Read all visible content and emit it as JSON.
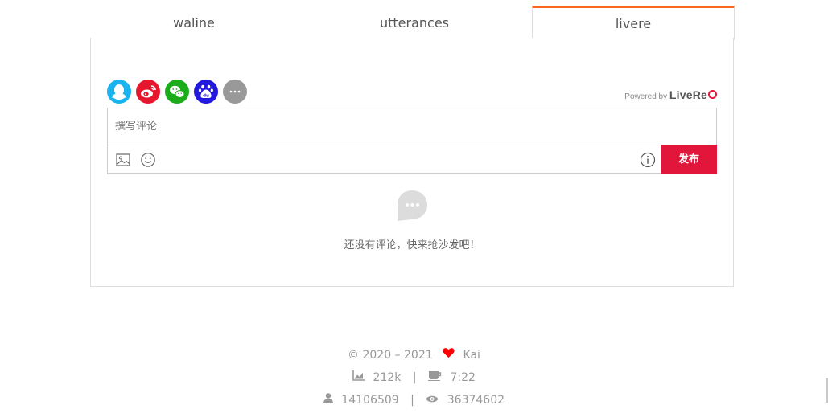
{
  "tabs": [
    {
      "label": "waline"
    },
    {
      "label": "utterances"
    },
    {
      "label": "livere",
      "active": true
    }
  ],
  "accent_color": "#fc6423",
  "livere": {
    "social_logins": [
      {
        "icon": "qq-icon",
        "color": "#1ab3f0"
      },
      {
        "icon": "weibo-icon",
        "color": "#e6162d"
      },
      {
        "icon": "wechat-icon",
        "color": "#1aad19"
      },
      {
        "icon": "baidu-icon",
        "color": "#2319dc"
      },
      {
        "icon": "more-icon",
        "color": "#999999"
      }
    ],
    "powered_by": "Powered by",
    "brand": "LiveRe",
    "placeholder": "撰写评论",
    "publish_label": "发布",
    "publish_color": "#e2153b",
    "empty_text": "还没有评论，快来抢沙发吧！"
  },
  "footer": {
    "copyright": "© 2020 – 2021",
    "author": "Kai",
    "word_count": "212k",
    "reading_time": "7:22",
    "visitors": "14106509",
    "views": "36374602"
  }
}
